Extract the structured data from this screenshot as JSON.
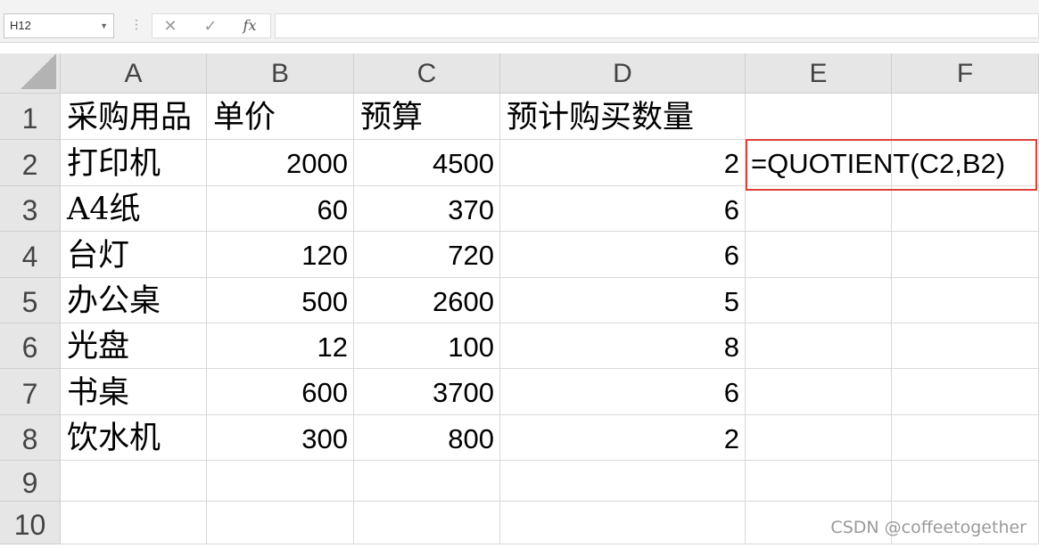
{
  "formula_bar": {
    "name_box": "H12",
    "cancel_icon": "✕",
    "enter_icon": "✓",
    "fx_label": "fx",
    "formula_value": ""
  },
  "columns": [
    "A",
    "B",
    "C",
    "D",
    "E",
    "F"
  ],
  "rows": [
    "1",
    "2",
    "3",
    "4",
    "5",
    "6",
    "7",
    "8",
    "9",
    "10"
  ],
  "cells": {
    "headers": [
      "采购用品",
      "单价",
      "预算",
      "预计购买数量"
    ],
    "data": [
      {
        "item": "打印机",
        "price": "2000",
        "budget": "4500",
        "qty": "2"
      },
      {
        "item": "A4纸",
        "price": "60",
        "budget": "370",
        "qty": "6"
      },
      {
        "item": "台灯",
        "price": "120",
        "budget": "720",
        "qty": "6"
      },
      {
        "item": "办公桌",
        "price": "500",
        "budget": "2600",
        "qty": "5"
      },
      {
        "item": "光盘",
        "price": "12",
        "budget": "100",
        "qty": "8"
      },
      {
        "item": "书桌",
        "price": "600",
        "budget": "3700",
        "qty": "6"
      },
      {
        "item": "饮水机",
        "price": "300",
        "budget": "800",
        "qty": "2"
      }
    ],
    "e2_formula": "=QUOTIENT(C2,B2)"
  },
  "watermark": "CSDN @coffeetogether",
  "colors": {
    "highlight": "#e0403a",
    "header_bg": "#e6e6e6",
    "grid": "#d9d9d9"
  }
}
